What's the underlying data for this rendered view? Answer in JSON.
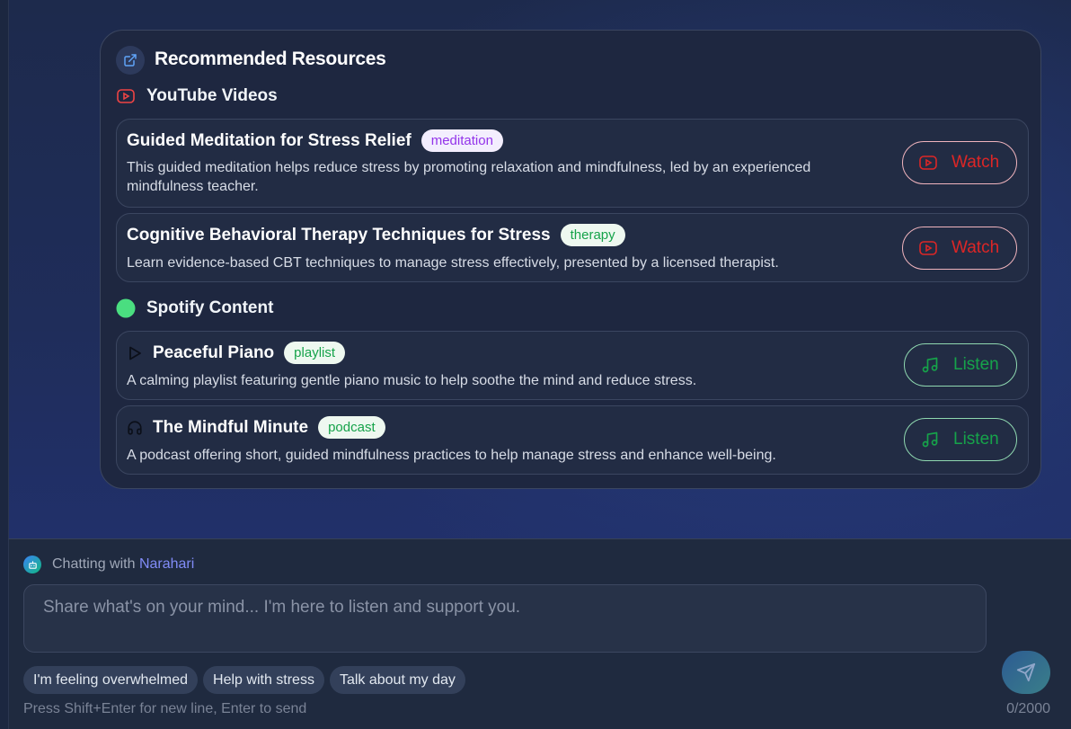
{
  "resources": {
    "title": "Recommended Resources",
    "youtube": {
      "heading": "YouTube Videos",
      "items": [
        {
          "title": "Guided Meditation for Stress Relief",
          "tag": "meditation",
          "description_line1": "This guided meditation helps reduce stress by promoting relaxation and mindfulness, led by an experienced",
          "description_line2": "mindfulness teacher.",
          "button": "Watch"
        },
        {
          "title": "Cognitive Behavioral Therapy Techniques for Stress",
          "tag": "therapy",
          "description_line1": "Learn evidence-based CBT techniques to manage stress effectively, presented by a licensed therapist.",
          "button": "Watch"
        }
      ]
    },
    "spotify": {
      "heading": "Spotify Content",
      "items": [
        {
          "title": "Peaceful Piano",
          "tag": "playlist",
          "icon": "play-icon",
          "description": "A calming playlist featuring gentle piano music to help soothe the mind and reduce stress.",
          "button": "Listen"
        },
        {
          "title": "The Mindful Minute",
          "tag": "podcast",
          "icon": "headphones-icon",
          "description": "A podcast offering short, guided mindfulness practices to help manage stress and enhance well-being.",
          "button": "Listen"
        }
      ]
    }
  },
  "composer": {
    "chatting_prefix": "Chatting with",
    "assistant_name": "Narahari",
    "placeholder": "Share what's on your mind... I'm here to listen and support you.",
    "suggestions": [
      "I'm feeling overwhelmed",
      "Help with stress",
      "Talk about my day"
    ],
    "hint": "Press Shift+Enter for new line, Enter to send",
    "counter": "0/2000"
  },
  "colors": {
    "youtube_red": "#dc2626",
    "spotify_green": "#16a34a",
    "accent_indigo": "#818cf8"
  }
}
